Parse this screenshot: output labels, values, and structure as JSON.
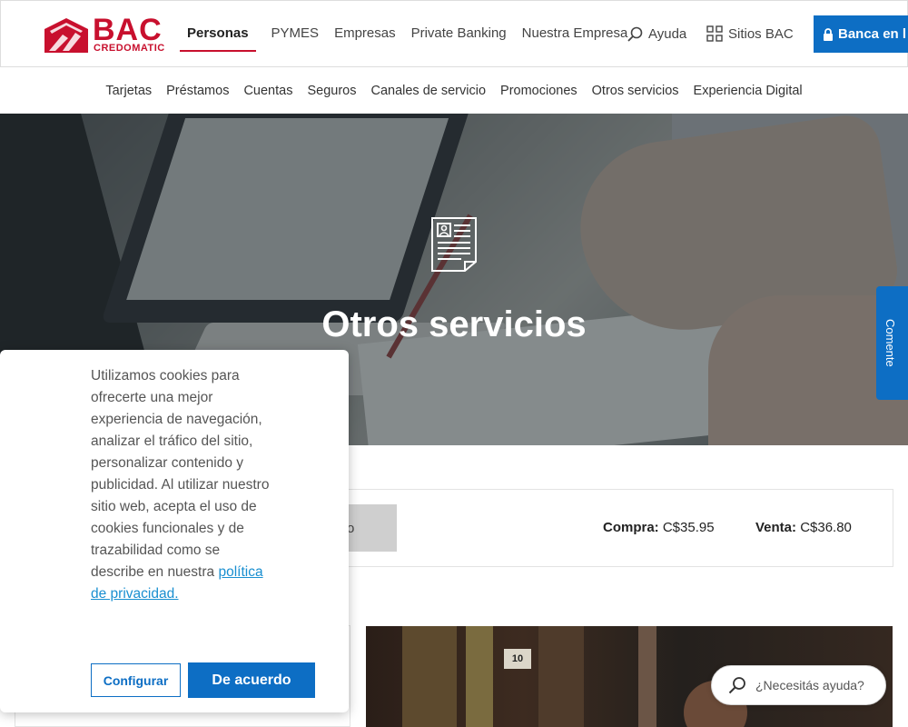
{
  "brand": {
    "name": "BAC",
    "subname": "CREDOMATIC",
    "color": "#c8102e",
    "accent": "#0d6ec4"
  },
  "nav_primary": [
    "Personas",
    "PYMES",
    "Empresas",
    "Private Banking",
    "Nuestra Empresa"
  ],
  "util": {
    "ayuda": "Ayuda",
    "sitios": "Sitios BAC",
    "banca": "Banca en l"
  },
  "nav_secondary": [
    "Tarjetas",
    "Préstamos",
    "Cuentas",
    "Seguros",
    "Canales de servicio",
    "Promociones",
    "Otros servicios",
    "Experiencia Digital"
  ],
  "hero": {
    "title": "Otros servicios"
  },
  "comente": "Comente",
  "rate": {
    "tab": "ro",
    "compra_label": "Compra:",
    "compra_value": "C$35.95",
    "venta_label": "Venta:",
    "venta_value": "C$36.80"
  },
  "lower": {
    "tag": "10"
  },
  "cookie": {
    "text": "Utilizamos cookies para ofrecerte una mejor experiencia de navegación, analizar el tráfico del sitio, personalizar contenido y publicidad. Al utilizar nuestro sitio web, acepta el uso de cookies funcionales y de trazabilidad como se describe en nuestra ",
    "link": "política de privacidad.",
    "configurar": "Configurar",
    "acuerdo": "De acuerdo"
  },
  "help": {
    "placeholder": "¿Necesitás ayuda?"
  }
}
